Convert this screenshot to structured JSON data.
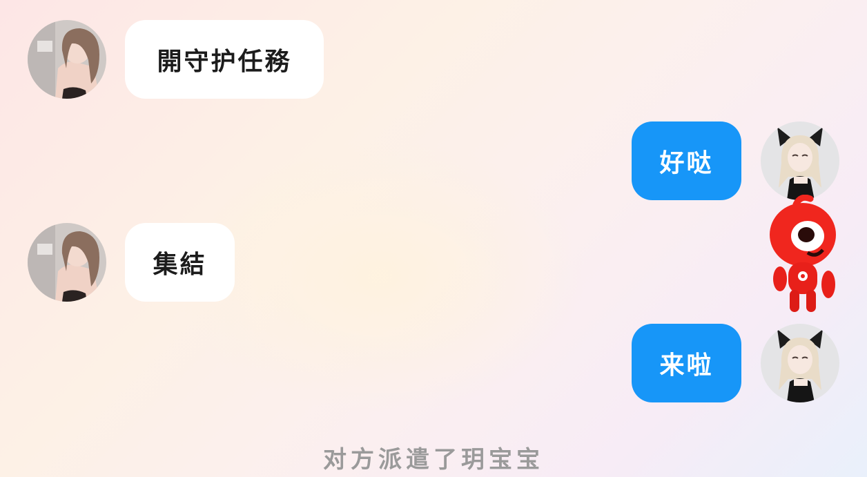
{
  "messages": [
    {
      "side": "left",
      "avatar": "woman-photo-avatar",
      "text": "開守护任務"
    },
    {
      "side": "right",
      "avatar": "anime-cat-girl-avatar",
      "text": "好哒"
    },
    {
      "side": "left",
      "avatar": "woman-photo-avatar",
      "text": "集結"
    },
    {
      "side": "right",
      "avatar": "anime-cat-girl-avatar",
      "text": "来啦"
    }
  ],
  "system_message": "对方派遣了玥宝宝",
  "colors": {
    "self_bubble": "#1796f8",
    "other_bubble": "#ffffff",
    "mascot": "#f0261e"
  },
  "icons": {
    "mascot": "red-mascot-sticker"
  }
}
